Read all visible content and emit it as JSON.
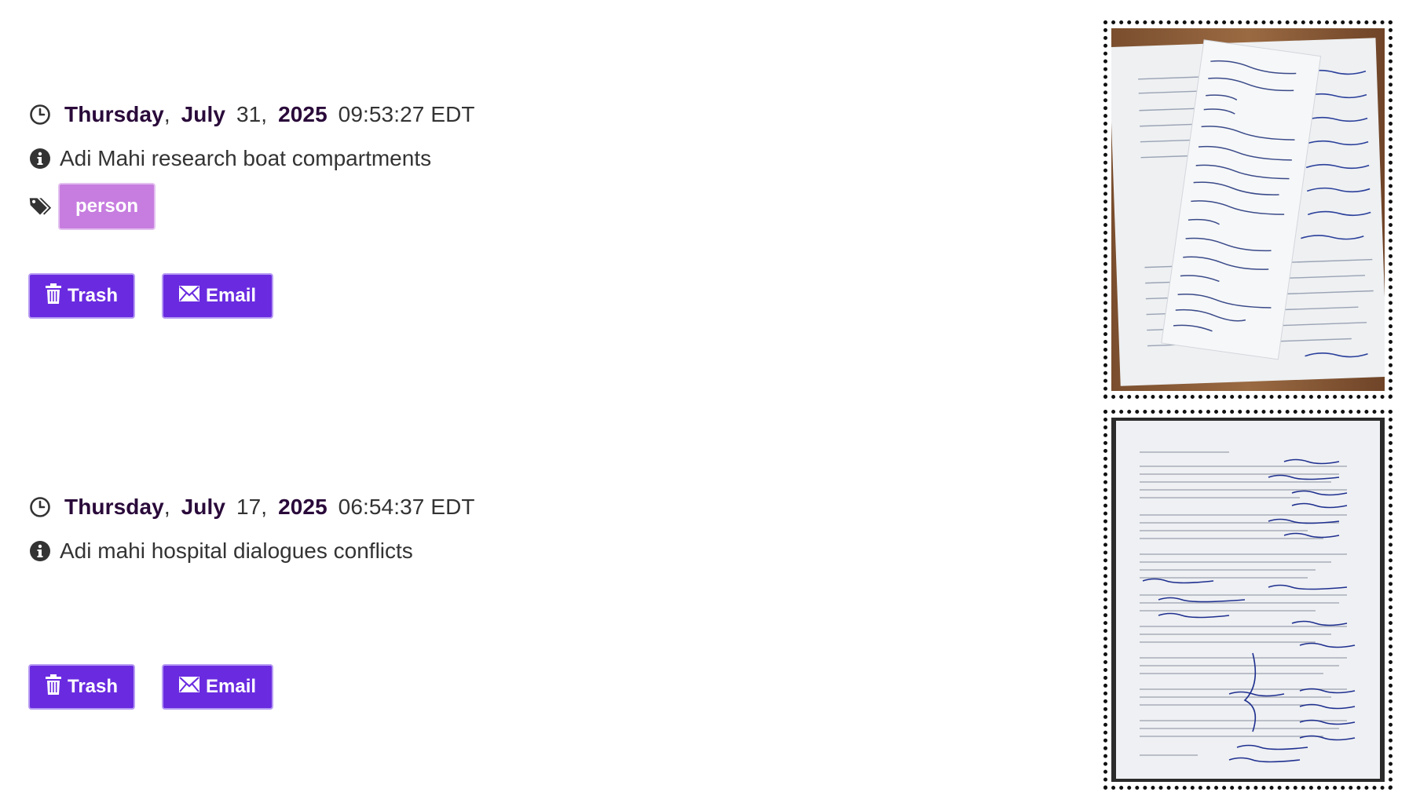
{
  "entries": [
    {
      "weekday": "Thursday",
      "month": "July",
      "day": "31,",
      "year": "2025",
      "time": "09:53:27 EDT",
      "description": "Adi Mahi research boat compartments",
      "tags": [
        "person"
      ],
      "trash_label": "Trash",
      "email_label": "Email",
      "thumbnail_icon": "handwritten-notes-photo"
    },
    {
      "weekday": "Thursday",
      "month": "July",
      "day": "17,",
      "year": "2025",
      "time": "06:54:37 EDT",
      "description": "Adi mahi hospital dialogues conflicts",
      "trash_label": "Trash",
      "email_label": "Email",
      "thumbnail_icon": "annotated-script-photo"
    }
  ],
  "icons": {
    "clock": "clock-icon",
    "info": "info-circle-icon",
    "tags": "tags-icon",
    "trash": "trash-icon",
    "email": "envelope-icon"
  },
  "colors": {
    "button_bg": "#6a2be0",
    "tag_bg": "#c77ddf",
    "date_emphasis": "#2a0a3a"
  }
}
